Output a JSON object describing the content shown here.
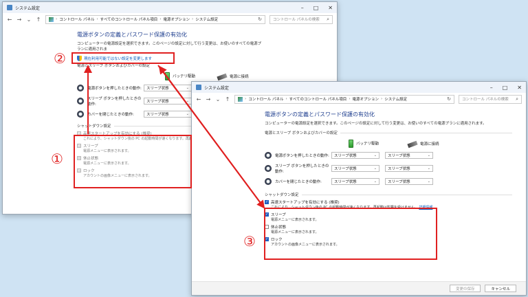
{
  "window_title": "システム設定",
  "breadcrumb": [
    "コントロール パネル",
    "すべてのコントロール パネル項目",
    "電源オプション",
    "システム設定"
  ],
  "search_placeholder": "コントロール パネルの検索",
  "heading": "電源ボタンの定義とパスワード保護の有効化",
  "description_back": "コンピューターの電源設定を選択できます。このページの設定に対して行う変更は、お使いのすべての電源プランに適用されま",
  "description_front": "コンピューターの電源設定を選択できます。このページの設定に対して行う変更は、お使いのすべての電源プランに適用されます。",
  "change_settings_link": "現在利用可能ではない設定を変更します",
  "power_section_title": "電源とスリープ ボタンおよびカバーの設定",
  "col_battery": "バッテリ駆動",
  "col_plugged": "電源に接続",
  "rows": [
    {
      "label": "電源ボタンを押したときの動作:",
      "battery": "スリープ状態",
      "plugged": "スリープ状態"
    },
    {
      "label": "スリープ ボタンを押したときの動作:",
      "battery": "スリープ状態",
      "plugged": "スリープ状態"
    },
    {
      "label": "カバーを閉じたときの動作:",
      "battery": "スリープ状態",
      "plugged": "スリープ状態"
    }
  ],
  "shutdown_section_title": "シャットダウン設定",
  "options": [
    {
      "label": "高速スタートアップを有効にする (推奨)",
      "desc": "これにより、シャットダウン後の PC の起動時間が速くなります。再起動は影響を受けません。",
      "more": "詳細情報",
      "checked": true
    },
    {
      "label": "スリープ",
      "desc": "電源メニューに表示されます。",
      "checked": true
    },
    {
      "label": "休止状態",
      "desc": "電源メニューに表示されます。",
      "checked": false
    },
    {
      "label": "ロック",
      "desc": "アカウントの画像メニューに表示されます。",
      "checked": true
    }
  ],
  "back_options_desc0": "これにより、シャットダウン後の PC の起動時間が速くなります。再起動",
  "save_button": "変更の保存",
  "cancel_button": "キャンセル",
  "callouts": {
    "one": "①",
    "two": "②",
    "three": "③"
  },
  "accent_color": "#e02020"
}
